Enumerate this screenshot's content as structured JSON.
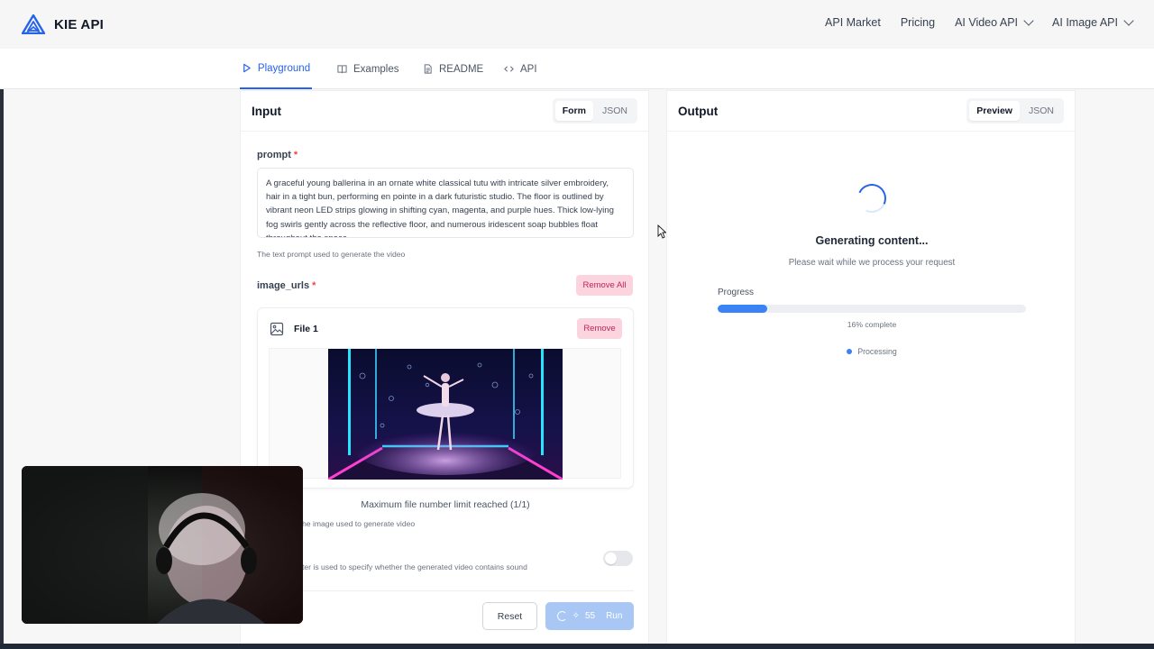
{
  "brand": {
    "name": "KIE API"
  },
  "topnav": {
    "items": [
      {
        "label": "API Market",
        "has_dropdown": false
      },
      {
        "label": "Pricing",
        "has_dropdown": false
      },
      {
        "label": "AI Video API",
        "has_dropdown": true
      },
      {
        "label": "AI Image API",
        "has_dropdown": true
      }
    ]
  },
  "tabs": [
    {
      "label": "Playground",
      "icon": "play-icon",
      "active": true
    },
    {
      "label": "Examples",
      "icon": "book-icon",
      "active": false
    },
    {
      "label": "README",
      "icon": "document-icon",
      "active": false
    },
    {
      "label": "API",
      "icon": "code-icon",
      "active": false
    }
  ],
  "input": {
    "title": "Input",
    "mode_options": [
      "Form",
      "JSON"
    ],
    "mode_selected": "Form",
    "prompt": {
      "label": "prompt",
      "required_mark": "*",
      "value": "A graceful young ballerina in an ornate white classical tutu with intricate silver embroidery, hair in a tight bun, performing en pointe in a dark futuristic studio. The floor is outlined by vibrant neon LED strips glowing in shifting cyan, magenta, and purple hues. Thick low-lying fog swirls gently across the reflective floor, and numerous iridescent soap bubbles float throughout the space.",
      "help": "The text prompt used to generate the video"
    },
    "image_urls": {
      "label": "image_urls",
      "required_mark": "*",
      "remove_all_label": "Remove All",
      "file_title": "File 1",
      "remove_label": "Remove",
      "limit_text": "Maximum file number limit reached (1/1)",
      "help": "he image used to generate video"
    },
    "sound": {
      "help": "ter is used to specify whether the generated video contains sound",
      "enabled": false
    },
    "actions": {
      "reset_label": "Reset",
      "run_cost": "55",
      "run_label": "Run"
    }
  },
  "output": {
    "title": "Output",
    "mode_options": [
      "Preview",
      "JSON"
    ],
    "mode_selected": "Preview",
    "status_title": "Generating content...",
    "status_sub": "Please wait while we process your request",
    "progress_label": "Progress",
    "progress_percent": 16,
    "progress_text": "16% complete",
    "state_label": "Processing"
  },
  "colors": {
    "accent": "#2563eb",
    "danger_bg": "#fbd4df",
    "danger_text": "#c0265a"
  }
}
